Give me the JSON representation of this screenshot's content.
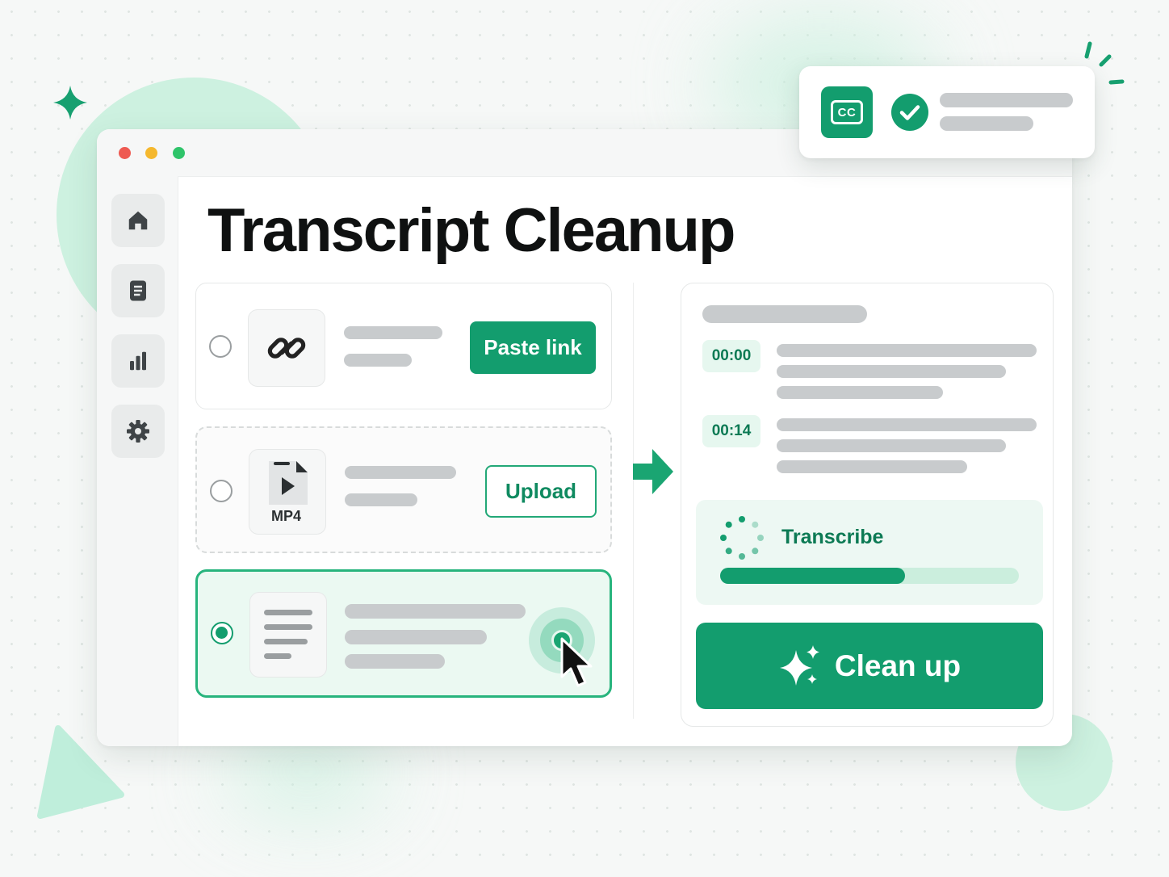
{
  "colors": {
    "accent": "#139d6e",
    "accent_light": "#e6f7ef",
    "mint_decor": "#cdf1e0",
    "placeholder_bar": "#c8cbcd",
    "title_text": "#0f1111",
    "traffic_red": "#ee5a52",
    "traffic_yellow": "#f5b82e",
    "traffic_green": "#2fc46a"
  },
  "window": {
    "controls": [
      "close",
      "minimize",
      "maximize"
    ]
  },
  "sidebar": {
    "items": [
      {
        "icon": "home-icon"
      },
      {
        "icon": "document-icon"
      },
      {
        "icon": "bar-chart-icon"
      },
      {
        "icon": "gear-icon"
      }
    ]
  },
  "page": {
    "title": "Transcript Cleanup"
  },
  "sources": [
    {
      "icon": "link-icon",
      "button_label": "Paste link",
      "selected": false
    },
    {
      "icon": "mp4-file-icon",
      "file_badge": "MP4",
      "button_label": "Upload",
      "selected": false
    },
    {
      "icon": "text-lines-icon",
      "selected": true
    }
  ],
  "transcript": {
    "entries": [
      {
        "timestamp": "00:00"
      },
      {
        "timestamp": "00:14"
      }
    ],
    "progress": {
      "label": "Transcribe",
      "value_fraction": 0.62
    },
    "cleanup_button_label": "Clean up"
  },
  "notification": {
    "icon": "closed-captions-icon",
    "badge": "CC",
    "status_icon": "check-circle-icon"
  }
}
